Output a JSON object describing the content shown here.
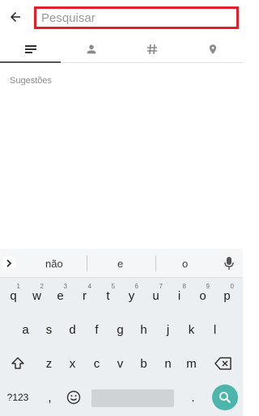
{
  "header": {
    "back_icon": "arrow-left-icon",
    "search_placeholder": "Pesquisar",
    "search_value": "",
    "highlight_color": "#e0202a"
  },
  "tabs": [
    {
      "icon": "lines-icon",
      "active": true
    },
    {
      "icon": "person-icon",
      "active": false
    },
    {
      "icon": "hashtag-icon",
      "active": false
    },
    {
      "icon": "location-pin-icon",
      "active": false
    }
  ],
  "suggestions_label": "Sugestões",
  "keyboard": {
    "suggestion_words": [
      "não",
      "e",
      "o"
    ],
    "row1": [
      {
        "key": "q",
        "num": "1"
      },
      {
        "key": "w",
        "num": "2"
      },
      {
        "key": "e",
        "num": "3"
      },
      {
        "key": "r",
        "num": "4"
      },
      {
        "key": "t",
        "num": "5"
      },
      {
        "key": "y",
        "num": "6"
      },
      {
        "key": "u",
        "num": "7"
      },
      {
        "key": "i",
        "num": "8"
      },
      {
        "key": "o",
        "num": "9"
      },
      {
        "key": "p",
        "num": "0"
      }
    ],
    "row2": [
      "a",
      "s",
      "d",
      "f",
      "g",
      "h",
      "j",
      "k",
      "l"
    ],
    "row3": [
      "z",
      "x",
      "c",
      "v",
      "b",
      "n",
      "m"
    ],
    "symbols_label": "?123",
    "comma": ",",
    "period": ".",
    "accent_color": "#4db6ac"
  }
}
